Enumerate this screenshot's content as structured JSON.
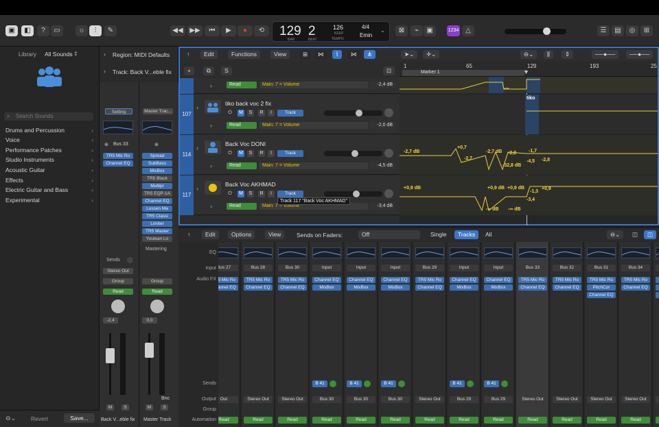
{
  "transport": {
    "bar": "129",
    "beat": "2",
    "bar_lbl": "BAR",
    "beat_lbl": "BEAT",
    "tempo": "126",
    "keep": "KEEP",
    "tempo_lbl": "TEMPO",
    "sig": "4/4",
    "key": "Emin",
    "counter_badge": "1234"
  },
  "library": {
    "title": "Library",
    "all_sounds": "All Sounds",
    "search_placeholder": "Search Sounds",
    "items": [
      "Drums and Percussion",
      "Voice",
      "Performance Patches",
      "Studio Instruments",
      "Acoustic Guitar",
      "Effects",
      "Electric Guitar and Bass",
      "Experimental"
    ],
    "revert": "Revert",
    "save": "Save..."
  },
  "inspector": {
    "region": "Region: MIDI Defaults",
    "track": "Track: Back V...eble fix",
    "setting": "Setting",
    "master_track_btn": "Master Trac...",
    "bus": "Bus 33",
    "left_plugins": [
      "TR5 Mic Ro",
      "Channel EQ"
    ],
    "right_plugins": [
      "Spread",
      "SubBass",
      "MixBox",
      "TR5 Black",
      "Multipr",
      "TR5 EQP-1A",
      "Channel EQ",
      "Lussen Ma",
      "TR5 Classi",
      "Limiter",
      "TR5 Master",
      "Youlean Lo"
    ],
    "mastering": "Mastering",
    "sends": "Sends",
    "stereo_out": "Stereo Out",
    "group": "Group",
    "read": "Read",
    "val_left": "-2,4",
    "val_right": "0,0",
    "bnc": "Bnc",
    "m": "M",
    "s": "S",
    "name_left": "Back V...eble fix",
    "name_right": "Master Track"
  },
  "arrange_toolbar": {
    "edit": "Edit",
    "functions": "Functions",
    "view": "View",
    "s_btn": "S"
  },
  "ruler": {
    "marks": [
      "1",
      "65",
      "129",
      "193",
      "25"
    ],
    "marker": "Marker 1"
  },
  "tracks": [
    {
      "num": "",
      "name": "",
      "read": "Read",
      "param": "Main: 7 = Volume",
      "db": "-2,4 dB"
    },
    {
      "num": "107",
      "name": "tiko back voc 2 fix",
      "read": "Read",
      "param": "Main: 7 = Volume",
      "db": "-2,0 dB",
      "track_btn": "Track"
    },
    {
      "num": "114",
      "name": "Back Voc DONI",
      "read": "Read",
      "param": "Main: 7 = Volume",
      "db": "-4,5 dB",
      "track_btn": "Track"
    },
    {
      "num": "117",
      "name": "Back Voc AKHMAD",
      "read": "Read",
      "param": "Main: 7 = Volume",
      "db": "-3,4 dB",
      "track_btn": "Track",
      "tooltip": "Track 117 \"Back Voc AKHMAD\""
    }
  ],
  "msri": {
    "m": "M",
    "s": "S",
    "r": "R",
    "i": "I"
  },
  "automation_labels": [
    "-∞",
    "-∞",
    "tiko",
    "-2,7 dB",
    "+0,7",
    "-2,7",
    "-2,7 dB",
    "-2,8",
    "-32,8 dB",
    "-4,5",
    "-1,7",
    "-2,8",
    "+0,9 dB",
    "+0,9 dB",
    "+0,9 dB",
    "-1,3",
    "+0,9",
    "-∞ dB",
    "-∞ dB",
    "-3,4"
  ],
  "mixer_toolbar": {
    "edit": "Edit",
    "options": "Options",
    "view": "View",
    "sends_on_faders": "Sends on Faders:",
    "off": "Off",
    "single": "Single",
    "tracks": "Tracks",
    "all": "All"
  },
  "mixer_rows": {
    "eq": "EQ",
    "input": "Input",
    "audio_fx": "Audio FX",
    "sends": "Sends",
    "output": "Output",
    "group": "Group",
    "automation": "Automation"
  },
  "strips": [
    {
      "input": "Bus 27",
      "fx": [
        "TR5 Mic Ro",
        "Channel EQ"
      ],
      "send": "",
      "output": "Out",
      "auto": "Read"
    },
    {
      "input": "Bus 28",
      "fx": [
        "TR5 Mic Ro",
        "Channel EQ"
      ],
      "send": "",
      "output": "Stereo Out",
      "auto": "Read"
    },
    {
      "input": "Bus 30",
      "fx": [
        "TR5 Mic Ro",
        "Channel EQ"
      ],
      "send": "",
      "output": "Stereo Out",
      "auto": "Read"
    },
    {
      "input": "Input",
      "fx": [
        "Channel EQ",
        "MixBox"
      ],
      "send": "B 41",
      "output": "Bus 30",
      "auto": "Read"
    },
    {
      "input": "Input",
      "fx": [
        "Channel EQ",
        "MixBox"
      ],
      "send": "B 41",
      "output": "Bus 30",
      "auto": "Read"
    },
    {
      "input": "Input",
      "fx": [
        "Channel EQ",
        "MixBox"
      ],
      "send": "B 41",
      "output": "Bus 30",
      "auto": "Read"
    },
    {
      "input": "Bus 29",
      "fx": [
        "TR5 Mic Ro",
        "Channel EQ"
      ],
      "send": "",
      "output": "Stereo Out",
      "auto": "Read"
    },
    {
      "input": "Input",
      "fx": [
        "Channel EQ",
        "MixBox"
      ],
      "send": "B 41",
      "output": "Bus 29",
      "auto": "Read"
    },
    {
      "input": "Input",
      "fx": [
        "Channel EQ",
        "MixBox"
      ],
      "send": "B 41",
      "output": "Bus 29",
      "auto": "Read"
    },
    {
      "input": "Bus 33",
      "fx": [
        "TR5 Mic Ro",
        "Channel EQ"
      ],
      "send": "",
      "output": "Stereo Out",
      "auto": "Read"
    },
    {
      "input": "Bus 32",
      "fx": [
        "TR5 Mic Ro",
        "Channel EQ"
      ],
      "send": "",
      "output": "Stereo Out",
      "auto": "Read"
    },
    {
      "input": "Bus 31",
      "fx": [
        "TR5 Mic Ro",
        "PitchCor",
        "Channel EQ"
      ],
      "send": "",
      "output": "Stereo Out",
      "auto": "Read"
    },
    {
      "input": "Bus 34",
      "fx": [
        "TR5 Mic Ro",
        "Channel EQ"
      ],
      "send": "",
      "output": "Stereo Out",
      "auto": "Read"
    },
    {
      "input": "",
      "fx": [
        "Ch",
        "Sp",
        "Char"
      ],
      "send": "",
      "output": "",
      "auto": "Read"
    }
  ]
}
